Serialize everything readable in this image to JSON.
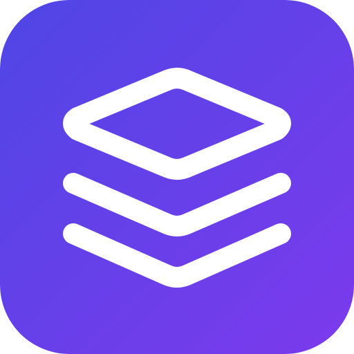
{
  "icon": {
    "name": "layers-icon",
    "gradient_start": "#4f46e5",
    "gradient_end": "#7c3aed",
    "glyph_color": "#ffffff"
  }
}
